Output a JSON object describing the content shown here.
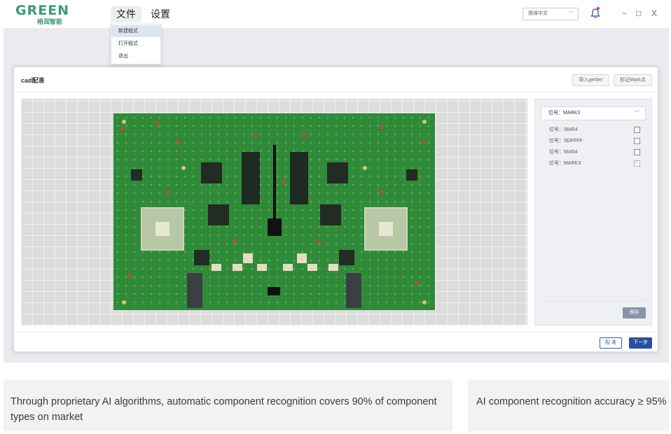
{
  "header": {
    "logo_main": "GREEN",
    "logo_sub": "格润智能",
    "menu": {
      "file": "文件",
      "settings": "设置"
    },
    "language": "简体中文",
    "window_controls": {
      "minimize": "−",
      "maximize": "□",
      "close": "X"
    }
  },
  "file_menu": {
    "items": [
      {
        "label": "新建程式",
        "active": true
      },
      {
        "label": "打开程式",
        "active": false
      },
      {
        "label": "退出",
        "active": false
      }
    ]
  },
  "card": {
    "title": "cad配准",
    "import_gerber": "导入gerber",
    "mark_point": "标记Mark点",
    "align_button": "配 准",
    "next_button": "下一步"
  },
  "right_panel": {
    "selected": "位号：MARK3",
    "items": [
      {
        "label": "位号：56454",
        "checked": false
      },
      {
        "label": "位号：SDFFFF",
        "checked": false
      },
      {
        "label": "位号：56454",
        "checked": false
      },
      {
        "label": "位号：MARK3",
        "checked": true
      }
    ],
    "save": "保存"
  },
  "captions": {
    "left": "Through proprietary AI algorithms, automatic component recognition covers 90% of component types on market",
    "right": "AI component recognition accuracy ≥ 95%"
  },
  "colors": {
    "brand_green": "#3a9a78",
    "primary_blue": "#2b4ea0",
    "pcb_green": "#2f8a3a",
    "notification_red": "#e0413a"
  }
}
